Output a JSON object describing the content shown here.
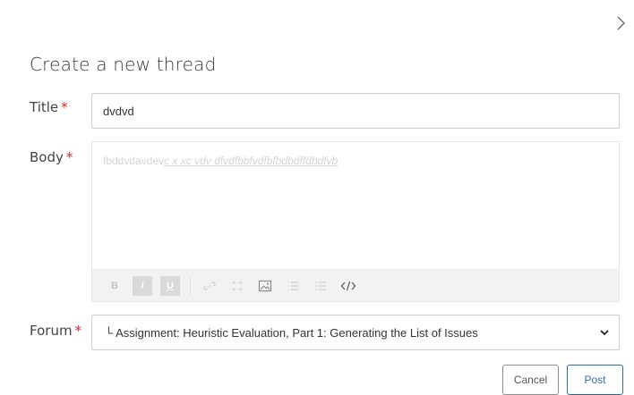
{
  "dialog": {
    "title": "Create a new thread",
    "close_icon": "chevron-right-icon"
  },
  "form": {
    "title_label": "Title",
    "title_value": "dvdvd",
    "body_label": "Body",
    "body_text_plain": "fbddvdavdev",
    "body_text_formatted": "c x xc vdv dfvdfbbfvdfbfbdbdffdbdfvb",
    "forum_label": "Forum",
    "forum_value": "└ Assignment: Heuristic Evaluation, Part 1: Generating the List of Issues",
    "required_marker": "*"
  },
  "toolbar": {
    "bold_label": "B",
    "italic_label": "I",
    "underline_label": "U",
    "icons": [
      "bold-icon",
      "italic-icon",
      "underline-icon",
      "link-icon",
      "unlink-icon",
      "image-icon",
      "numbered-list-icon",
      "bulleted-list-icon",
      "code-icon"
    ]
  },
  "actions": {
    "cancel_label": "Cancel",
    "post_label": "Post"
  },
  "colors": {
    "required": "#d9262a",
    "primary": "#2e6bb5",
    "toolbar_bg": "#f2f2f2"
  }
}
